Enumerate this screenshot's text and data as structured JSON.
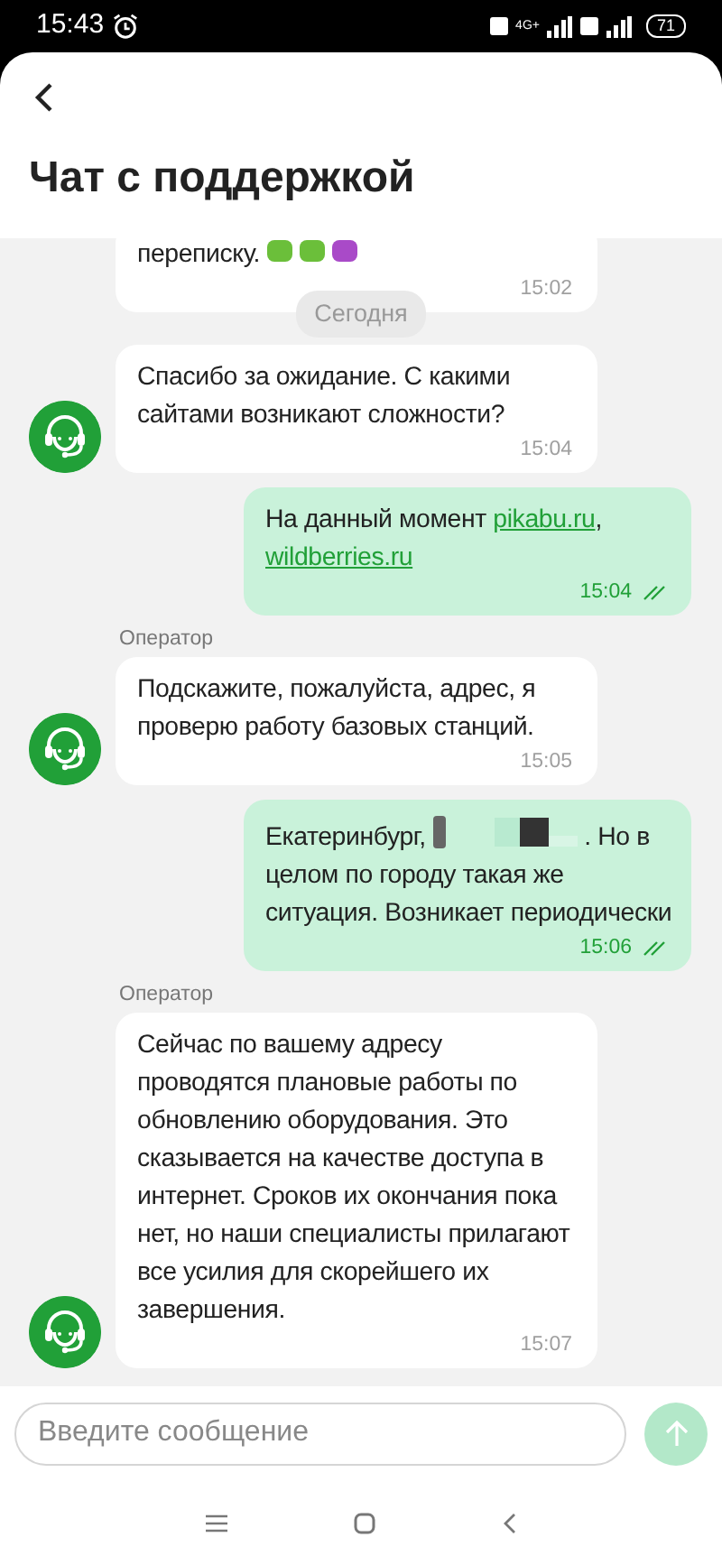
{
  "status_bar": {
    "time": "15:43",
    "network": "4G+",
    "battery": "71"
  },
  "header": {
    "title": "Чат с поддержкой"
  },
  "feed": [
    {
      "kind": "incoming",
      "avatar": false,
      "parts": [
        {
          "kind": "text",
          "text": "переписку. "
        },
        {
          "kind": "emoji"
        }
      ],
      "time": "15:02"
    },
    {
      "kind": "date",
      "text": "Сегодня"
    },
    {
      "kind": "incoming",
      "avatar": true,
      "parts": [
        {
          "kind": "text",
          "text": "Спасибо за ожидание. С какими сайтами возникают сложности?"
        }
      ],
      "time": "15:04"
    },
    {
      "kind": "outgoing",
      "read": true,
      "parts": [
        {
          "kind": "text",
          "text": "На данный момент "
        },
        {
          "kind": "link",
          "text": "pikabu.ru"
        },
        {
          "kind": "text",
          "text": ", "
        },
        {
          "kind": "link",
          "text": "wildberries.ru"
        }
      ],
      "time": "15:04"
    },
    {
      "kind": "sender",
      "text": "Оператор"
    },
    {
      "kind": "incoming",
      "avatar": true,
      "parts": [
        {
          "kind": "text",
          "text": "Подскажите, пожалуйста, адрес, я проверю работу базовых станций."
        }
      ],
      "time": "15:05"
    },
    {
      "kind": "outgoing",
      "read": true,
      "parts": [
        {
          "kind": "text",
          "text": "Екатеринбург, "
        },
        {
          "kind": "redacted"
        },
        {
          "kind": "text",
          "text": ". Но в целом по городу такая же ситуация. Возникает периодически"
        }
      ],
      "time": "15:06"
    },
    {
      "kind": "sender",
      "text": "Оператор"
    },
    {
      "kind": "incoming",
      "avatar": true,
      "parts": [
        {
          "kind": "text",
          "text": "Сейчас по вашему адресу проводятся плановые работы по обновлению оборудования. Это сказывается на качестве доступа в интернет. Сроков их окончания пока нет, но наши специалисты прилагают все усилия для скорейшего их завершения."
        }
      ],
      "time": "15:07"
    }
  ],
  "composer": {
    "placeholder": "Введите сообщение"
  }
}
